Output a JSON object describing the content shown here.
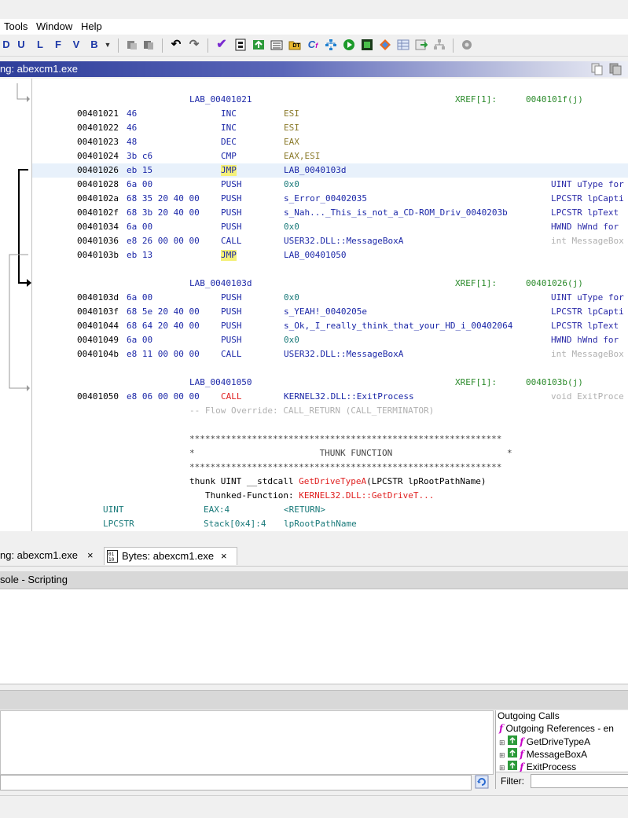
{
  "menu": {
    "items": [
      "Tools",
      "Window",
      "Help"
    ]
  },
  "toolbar": {
    "letters": [
      "D",
      "U",
      "L",
      "F",
      "V",
      "B"
    ]
  },
  "listing": {
    "title": "ng:  abexcm1.exe",
    "blocks": [
      {
        "label": "LAB_00401021",
        "xref": "XREF[1]:",
        "xref_target": "0040101f(j)"
      },
      {
        "label": "LAB_0040103d",
        "xref": "XREF[1]:",
        "xref_target": "00401026(j)"
      },
      {
        "label": "LAB_00401050",
        "xref": "XREF[1]:",
        "xref_target": "0040103b(j)"
      }
    ],
    "rows": [
      {
        "addr": "00401021",
        "bytes": "46",
        "mn": "INC",
        "op": "ESI",
        "cmt": ""
      },
      {
        "addr": "00401022",
        "bytes": "46",
        "mn": "INC",
        "op": "ESI",
        "cmt": ""
      },
      {
        "addr": "00401023",
        "bytes": "48",
        "mn": "DEC",
        "op": "EAX",
        "cmt": ""
      },
      {
        "addr": "00401024",
        "bytes": "3b c6",
        "mn": "CMP",
        "op": "EAX,ESI",
        "cmt": ""
      },
      {
        "addr": "00401026",
        "bytes": "eb 15",
        "mn": "JMP",
        "op": "LAB_0040103d",
        "cmt": ""
      },
      {
        "addr": "00401028",
        "bytes": "6a 00",
        "mn": "PUSH",
        "op": "0x0",
        "cmt": "UINT uType for"
      },
      {
        "addr": "0040102a",
        "bytes": "68 35 20 40 00",
        "mn": "PUSH",
        "op": "s_Error_00402035",
        "cmt": "LPCSTR lpCapti"
      },
      {
        "addr": "0040102f",
        "bytes": "68 3b 20 40 00",
        "mn": "PUSH",
        "op": "s_Nah..._This_is_not_a_CD-ROM_Driv_0040203b",
        "cmt": "LPCSTR lpText"
      },
      {
        "addr": "00401034",
        "bytes": "6a 00",
        "mn": "PUSH",
        "op": "0x0",
        "cmt": "HWND hWnd for"
      },
      {
        "addr": "00401036",
        "bytes": "e8 26 00 00 00",
        "mn": "CALL",
        "op": "USER32.DLL::MessageBoxA",
        "cmt": "int MessageBox"
      },
      {
        "addr": "0040103b",
        "bytes": "eb 13",
        "mn": "JMP",
        "op": "LAB_00401050",
        "cmt": ""
      },
      {
        "addr": "0040103d",
        "bytes": "6a 00",
        "mn": "PUSH",
        "op": "0x0",
        "cmt": "UINT uType for"
      },
      {
        "addr": "0040103f",
        "bytes": "68 5e 20 40 00",
        "mn": "PUSH",
        "op": "s_YEAH!_0040205e",
        "cmt": "LPCSTR lpCapti"
      },
      {
        "addr": "00401044",
        "bytes": "68 64 20 40 00",
        "mn": "PUSH",
        "op": "s_Ok,_I_really_think_that_your_HD_i_00402064",
        "cmt": "LPCSTR lpText"
      },
      {
        "addr": "00401049",
        "bytes": "6a 00",
        "mn": "PUSH",
        "op": "0x0",
        "cmt": "HWND hWnd for"
      },
      {
        "addr": "0040104b",
        "bytes": "e8 11 00 00 00",
        "mn": "CALL",
        "op": "USER32.DLL::MessageBoxA",
        "cmt": "int MessageBox"
      },
      {
        "addr": "00401050",
        "bytes": "e8 06 00 00 00",
        "mn": "CALL",
        "op": "KERNEL32.DLL::ExitProcess",
        "cmt": "void ExitProce"
      }
    ],
    "flow_override": "-- Flow Override: CALL_RETURN (CALL_TERMINATOR)",
    "stars": "************************************************************",
    "thunk_banner": "*                        THUNK FUNCTION                      *",
    "thunk_sig_prefix": "thunk UINT __stdcall ",
    "thunk_sig_name": "GetDriveTypeA",
    "thunk_sig_suffix": "(LPCSTR lpRootPathName)",
    "thunked_prefix": "Thunked-Function: ",
    "thunked_target": "KERNEL32.DLL::GetDriveT...",
    "params": [
      {
        "type": "UINT",
        "storage": "EAX:4",
        "name": "<RETURN>"
      },
      {
        "type": "LPCSTR",
        "storage": "Stack[0x4]:4",
        "name": "lpRootPathName"
      }
    ]
  },
  "tabs": [
    {
      "label": "ng:  abexcm1.exe",
      "close": "×"
    },
    {
      "label": "Bytes: abexcm1.exe",
      "close": "×"
    }
  ],
  "console": {
    "title": "sole - Scripting"
  },
  "outgoing": {
    "title": "Outgoing Calls",
    "root": "Outgoing References - en",
    "items": [
      "GetDriveTypeA",
      "MessageBoxA",
      "ExitProcess"
    ],
    "filter_label": "Filter:"
  }
}
